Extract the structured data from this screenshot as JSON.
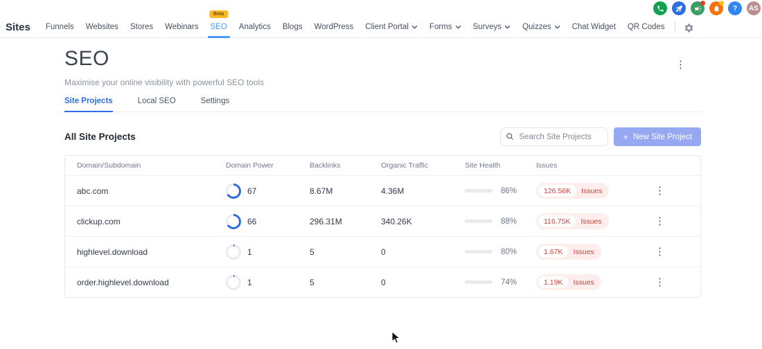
{
  "topbar": {
    "icons": [
      {
        "name": "phone",
        "bg": "#12a150"
      },
      {
        "name": "rocket",
        "bg": "#2b6fe3"
      },
      {
        "name": "megaphone",
        "bg": "#3a9d64",
        "badge": "#e83c31"
      },
      {
        "name": "bell",
        "bg": "#f4730c",
        "badge": "#fbbf24"
      },
      {
        "name": "help",
        "bg": "#3087f0",
        "glyph": "?"
      },
      {
        "name": "avatar",
        "bg": "#b98e90",
        "glyph": "AS"
      }
    ]
  },
  "nav": {
    "brand": "Sites",
    "beta_label": "Beta",
    "items": [
      {
        "label": "Funnels"
      },
      {
        "label": "Websites"
      },
      {
        "label": "Stores"
      },
      {
        "label": "Webinars"
      },
      {
        "label": "SEO"
      },
      {
        "label": "Analytics"
      },
      {
        "label": "Blogs"
      },
      {
        "label": "WordPress"
      },
      {
        "label": "Client Portal"
      },
      {
        "label": "Forms"
      },
      {
        "label": "Surveys"
      },
      {
        "label": "Quizzes"
      },
      {
        "label": "Chat Widget"
      },
      {
        "label": "QR Codes"
      }
    ]
  },
  "header": {
    "title": "SEO",
    "subtitle": "Maximise your online visibility with powerful SEO tools"
  },
  "tabs": [
    {
      "label": "Site Projects"
    },
    {
      "label": "Local SEO"
    },
    {
      "label": "Settings"
    }
  ],
  "section": {
    "title": "All Site Projects",
    "search_placeholder": "Search Site Projects",
    "new_button_plus": "+",
    "new_button_label": "New Site Project"
  },
  "table": {
    "columns": [
      "Domain/Subdomain",
      "Domain Power",
      "Backlinks",
      "Organic Traffic",
      "Site Health",
      "Issues"
    ],
    "issues_label": "Issues",
    "rows": [
      {
        "domain": "abc.com",
        "power": 67,
        "backlinks": "8.67M",
        "organic": "4.36M",
        "health": 86,
        "health_label": "86%",
        "health_color": "green",
        "issues_count": "126.56K"
      },
      {
        "domain": "clickup.com",
        "power": 66,
        "backlinks": "296.31M",
        "organic": "340.26K",
        "health": 88,
        "health_label": "88%",
        "health_color": "green",
        "issues_count": "116.75K"
      },
      {
        "domain": "highlevel.download",
        "power": 1,
        "backlinks": "5",
        "organic": "0",
        "health": 80,
        "health_label": "80%",
        "health_color": "green",
        "issues_count": "1.67K"
      },
      {
        "domain": "order.highlevel.download",
        "power": 1,
        "backlinks": "5",
        "organic": "0",
        "health": 74,
        "health_label": "74%",
        "health_color": "orange",
        "issues_count": "1.19K"
      }
    ]
  },
  "icons": {
    "kebab": "⋮"
  },
  "colors": {
    "green": "#29b573",
    "orange": "#efa12e",
    "ring_fill": "#2f6ce0",
    "ring_track": "#e8ecf2",
    "accent": "#4a97f5",
    "tab_active": "#2d6ce5",
    "issues_red": "#c5453e",
    "issues_bg": "#fdeeed",
    "beta_bg": "#fbb724",
    "button_bg": "#97a8f2"
  }
}
